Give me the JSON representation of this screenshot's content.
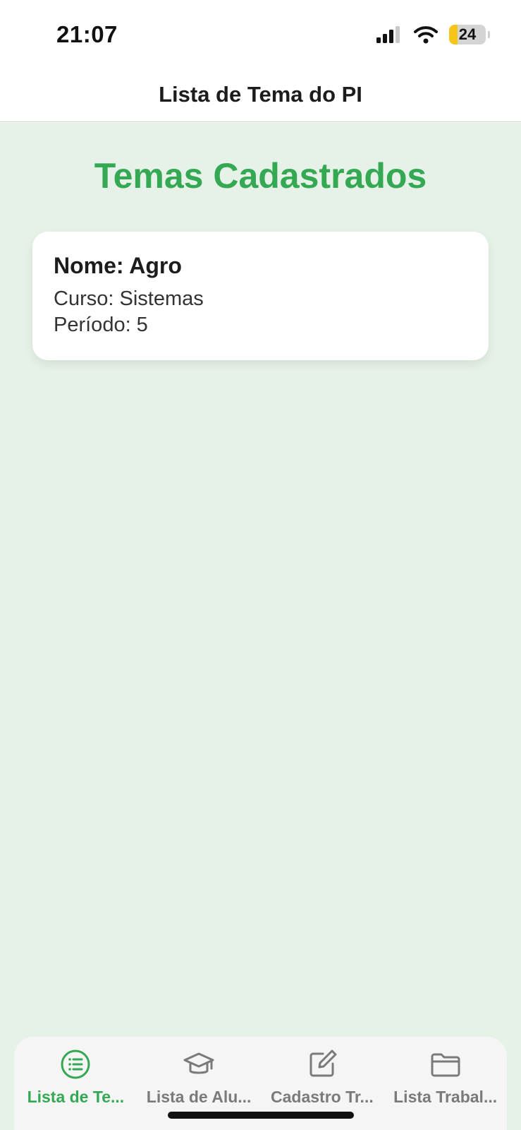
{
  "status_bar": {
    "time": "21:07",
    "battery_level": "24",
    "battery_fraction": 0.24,
    "icons": [
      "signal-icon",
      "wifi-icon",
      "battery-icon"
    ]
  },
  "header": {
    "title": "Lista de Tema do PI"
  },
  "main": {
    "heading": "Temas Cadastrados",
    "cards": [
      {
        "name": "Nome: Agro",
        "course": "Curso: Sistemas",
        "period": "Período: 5"
      }
    ]
  },
  "tab_bar": {
    "active_index": 0,
    "tabs": [
      {
        "label": "Lista de Te...",
        "icon": "list-icon"
      },
      {
        "label": "Lista de Alu...",
        "icon": "graduation-cap-icon"
      },
      {
        "label": "Cadastro Tr...",
        "icon": "edit-icon"
      },
      {
        "label": "Lista Trabal...",
        "icon": "folder-icon"
      }
    ]
  },
  "colors": {
    "accent": "#34a853",
    "background": "#e6f2e8",
    "inactive": "#7a7a7a"
  }
}
